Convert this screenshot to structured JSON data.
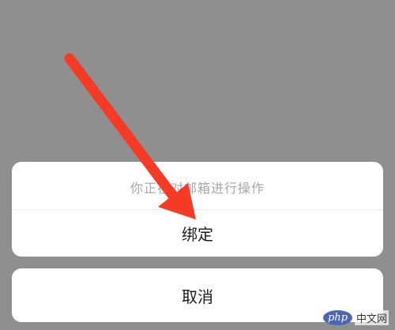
{
  "action_sheet": {
    "title": "你正在对邮箱进行操作",
    "actions": [
      {
        "label": "绑定"
      }
    ],
    "cancel_label": "取消"
  },
  "annotation": {
    "arrow_color": "#f53a26"
  },
  "watermark": {
    "logo": "php",
    "text": "中文网"
  },
  "colors": {
    "overlay": "#8f8f8f",
    "sheet_bg": "#ffffff",
    "title_text": "#a6a6a6",
    "action_text": "#1a1a1a"
  }
}
